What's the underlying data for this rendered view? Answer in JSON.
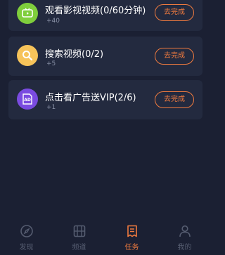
{
  "tasks": [
    {
      "title": "观看影视视频(0/60分钟)",
      "reward": "+40",
      "button": "去完成",
      "icon": "tv-icon",
      "color": "#7fce3c"
    },
    {
      "title": "搜索视频(0/2)",
      "reward": "+5",
      "button": "去完成",
      "icon": "search-icon",
      "color": "#f6c35a"
    },
    {
      "title": "点击看广告送VIP(2/6)",
      "reward": "+1",
      "button": "去完成",
      "icon": "ad-icon",
      "color": "#7a4be0"
    }
  ],
  "nav": {
    "items": [
      {
        "label": "发现",
        "icon": "compass-icon",
        "active": false
      },
      {
        "label": "频道",
        "icon": "film-icon",
        "active": false
      },
      {
        "label": "任务",
        "icon": "task-list-icon",
        "active": true
      },
      {
        "label": "我的",
        "icon": "user-icon",
        "active": false
      }
    ],
    "active_color": "#f07b3f",
    "inactive_color": "#555c70"
  }
}
